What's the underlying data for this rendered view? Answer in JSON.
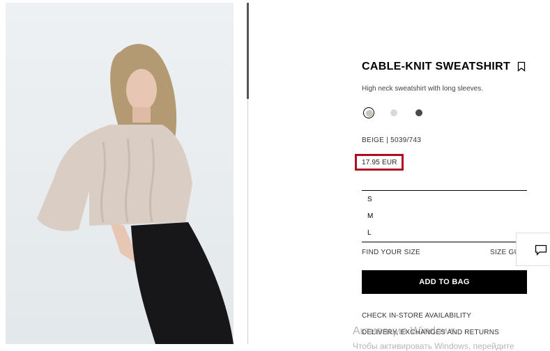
{
  "product": {
    "title": "CABLE-KNIT SWEATSHIRT",
    "description": "High neck sweatshirt with long sleeves.",
    "color_code": "BEIGE | 5039/743",
    "price": "17.95 EUR",
    "swatches": [
      {
        "name": "beige",
        "color": "#c9c3bb",
        "selected": true
      },
      {
        "name": "light-grey",
        "color": "#d9d9d6",
        "selected": false
      },
      {
        "name": "dark-grey",
        "color": "#4a4a4a",
        "selected": false
      }
    ],
    "sizes": [
      "S",
      "M",
      "L"
    ],
    "find_your_size": "FIND YOUR SIZE",
    "size_guide": "SIZE GUIDE",
    "add_to_bag": "ADD TO BAG",
    "links": [
      "CHECK IN-STORE AVAILABILITY",
      "DELIVERY, EXCHANGES AND RETURNS"
    ]
  },
  "watermark": {
    "line1": "Активация Windows",
    "line2": "Чтобы активировать Windows, перейдите"
  },
  "colors": {
    "highlight": "#b10d1e",
    "button_bg": "#000000",
    "sweater": "#d9cdc4",
    "skirt": "#17171a",
    "hair": "#b49a72"
  }
}
